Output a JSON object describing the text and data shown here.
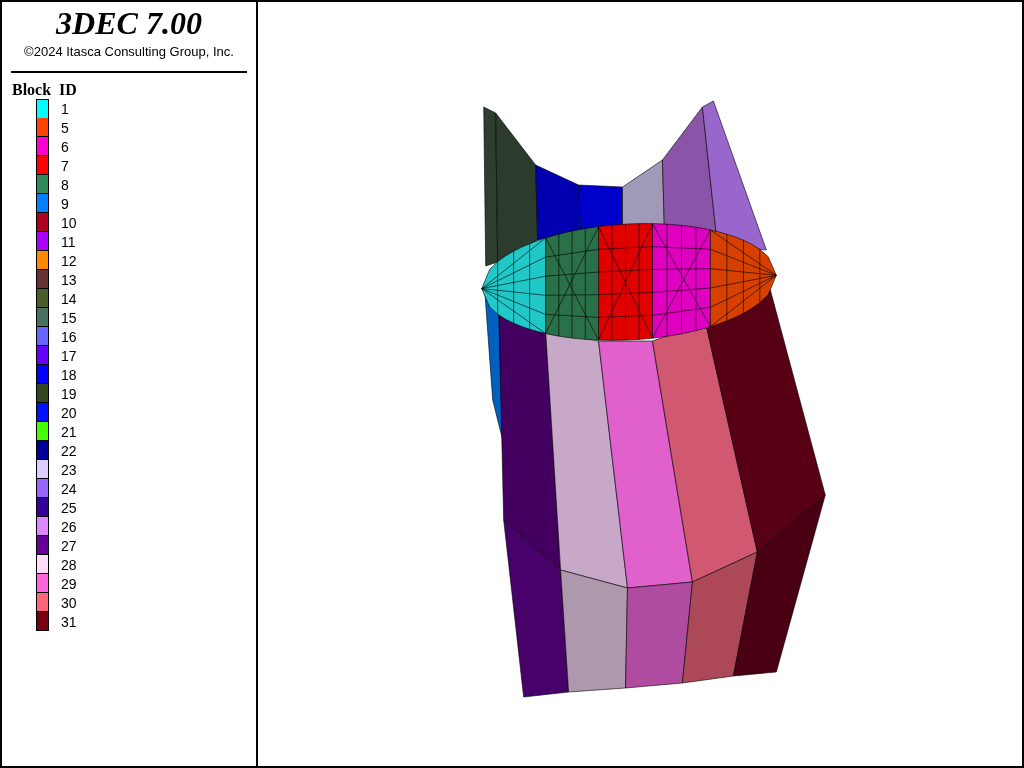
{
  "title": "3DEC 7.00",
  "copyright": "©2024 Itasca Consulting Group, Inc.",
  "legend": {
    "title": "Block  ID",
    "items": [
      {
        "label": "1",
        "color": "#00ffff"
      },
      {
        "label": "5",
        "color": "#ff4400"
      },
      {
        "label": "6",
        "color": "#ff00cc"
      },
      {
        "label": "7",
        "color": "#ff0000"
      },
      {
        "label": "8",
        "color": "#2e8b57"
      },
      {
        "label": "9",
        "color": "#0080ff"
      },
      {
        "label": "10",
        "color": "#b00020"
      },
      {
        "label": "11",
        "color": "#aa00ff"
      },
      {
        "label": "12",
        "color": "#ff8800"
      },
      {
        "label": "13",
        "color": "#663333"
      },
      {
        "label": "14",
        "color": "#4a5e2a"
      },
      {
        "label": "15",
        "color": "#4a7060"
      },
      {
        "label": "16",
        "color": "#6666ff"
      },
      {
        "label": "17",
        "color": "#6600ff"
      },
      {
        "label": "18",
        "color": "#0000ff"
      },
      {
        "label": "19",
        "color": "#334422"
      },
      {
        "label": "20",
        "color": "#0011ff"
      },
      {
        "label": "21",
        "color": "#44ff00"
      },
      {
        "label": "22",
        "color": "#000099"
      },
      {
        "label": "23",
        "color": "#ddccff"
      },
      {
        "label": "24",
        "color": "#9966ff"
      },
      {
        "label": "25",
        "color": "#330099"
      },
      {
        "label": "26",
        "color": "#dd88ff"
      },
      {
        "label": "27",
        "color": "#660099"
      },
      {
        "label": "28",
        "color": "#ffddf8"
      },
      {
        "label": "29",
        "color": "#ff66dd"
      },
      {
        "label": "30",
        "color": "#ff6677"
      },
      {
        "label": "31",
        "color": "#770011"
      }
    ]
  }
}
